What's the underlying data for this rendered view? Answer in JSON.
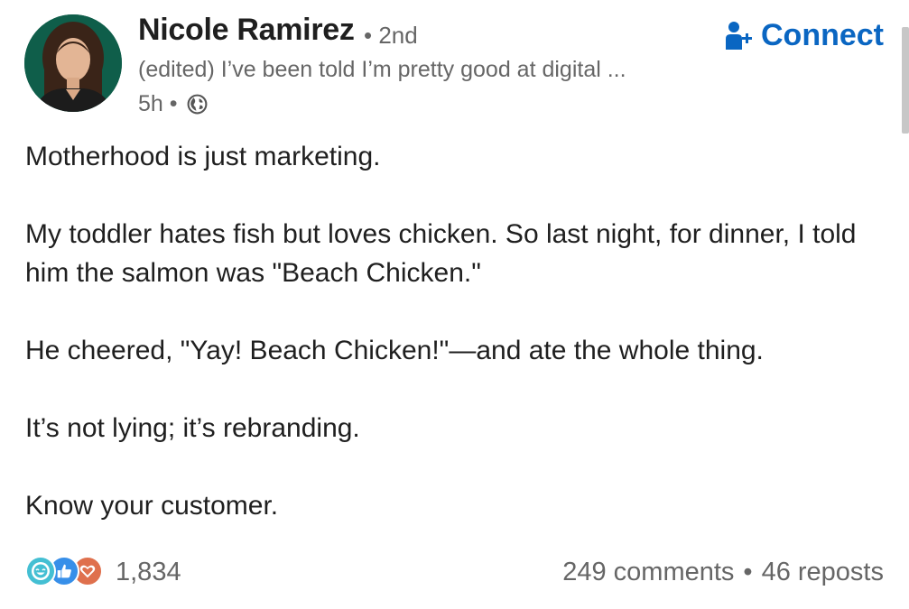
{
  "author": {
    "name": "Nicole Ramirez",
    "degree": "• 2nd",
    "headline": "(edited) I’ve been told I’m pretty good at digital ...",
    "time": "5h •",
    "visibility_icon": "globe-icon",
    "avatar_bg": "#0f5e4a"
  },
  "connect": {
    "label": "Connect",
    "icon": "add-person-icon",
    "color": "#0a66c2"
  },
  "post": {
    "paragraphs": [
      "Motherhood is just marketing.",
      "My toddler hates fish but loves chicken. So last night, for dinner, I told him the salmon was \"Beach Chicken.\"",
      "He cheered, \"Yay! Beach Chicken!\"—and ate the whole thing.",
      "It’s not lying; it’s rebranding.",
      "Know your customer."
    ]
  },
  "social": {
    "reaction_icons": [
      "funny-icon",
      "like-icon",
      "love-icon"
    ],
    "reaction_count": "1,834",
    "comments": "249 comments",
    "separator": "•",
    "reposts": "46 reposts"
  }
}
